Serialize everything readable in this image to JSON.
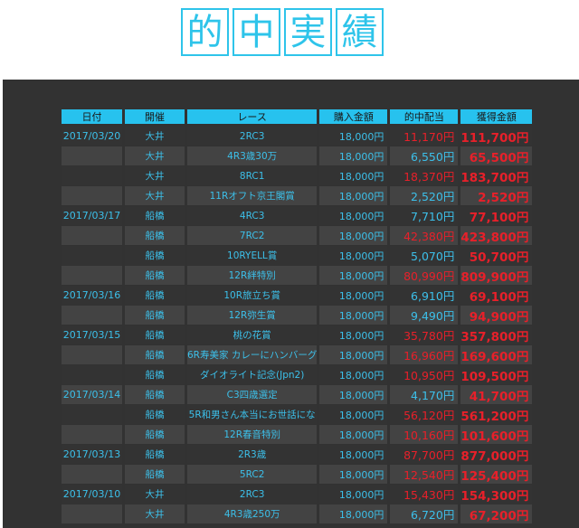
{
  "title": [
    "的",
    "中",
    "実",
    "績"
  ],
  "table": {
    "headers": [
      "日付",
      "開催",
      "レース",
      "購入金額",
      "的中配当",
      "獲得金額"
    ],
    "rows": [
      {
        "date": "2017/03/20",
        "venue": "大井",
        "race": "2RC3",
        "buy": "18,000円",
        "payout": "11,170円",
        "gain": "111,700円",
        "hit": true
      },
      {
        "date": "",
        "venue": "大井",
        "race": "4R3歳30万",
        "buy": "18,000円",
        "payout": "6,550円",
        "gain": "65,500円",
        "hit": false
      },
      {
        "date": "",
        "venue": "大井",
        "race": "8RC1",
        "buy": "18,000円",
        "payout": "18,370円",
        "gain": "183,700円",
        "hit": true
      },
      {
        "date": "",
        "venue": "大井",
        "race": "11Rオフト京王閣賞",
        "buy": "18,000円",
        "payout": "2,520円",
        "gain": "2,520円",
        "hit": false
      },
      {
        "date": "2017/03/17",
        "venue": "船橋",
        "race": "4RC3",
        "buy": "18,000円",
        "payout": "7,710円",
        "gain": "77,100円",
        "hit": false
      },
      {
        "date": "",
        "venue": "船橋",
        "race": "7RC2",
        "buy": "18,000円",
        "payout": "42,380円",
        "gain": "423,800円",
        "hit": true
      },
      {
        "date": "",
        "venue": "船橋",
        "race": "10RYELL賞",
        "buy": "18,000円",
        "payout": "5,070円",
        "gain": "50,700円",
        "hit": false
      },
      {
        "date": "",
        "venue": "船橋",
        "race": "12R絆特別",
        "buy": "18,000円",
        "payout": "80,990円",
        "gain": "809,900円",
        "hit": true
      },
      {
        "date": "2017/03/16",
        "venue": "船橋",
        "race": "10R旅立ち賞",
        "buy": "18,000円",
        "payout": "6,910円",
        "gain": "69,100円",
        "hit": false
      },
      {
        "date": "",
        "venue": "船橋",
        "race": "12R弥生賞",
        "buy": "18,000円",
        "payout": "9,490円",
        "gain": "94,900円",
        "hit": false
      },
      {
        "date": "2017/03/15",
        "venue": "船橋",
        "race": "桃の花賞",
        "buy": "18,000円",
        "payout": "35,780円",
        "gain": "357,800円",
        "hit": true
      },
      {
        "date": "",
        "venue": "船橋",
        "race": "6R寿美家 カレーにハンバーグ",
        "buy": "18,000円",
        "payout": "16,960円",
        "gain": "169,600円",
        "hit": true
      },
      {
        "date": "",
        "venue": "船橋",
        "race": "ダイオライト記念(Jpn2)",
        "buy": "18,000円",
        "payout": "10,950円",
        "gain": "109,500円",
        "hit": true
      },
      {
        "date": "2017/03/14",
        "venue": "船橋",
        "race": "C3四歳選定",
        "buy": "18,000円",
        "payout": "4,170円",
        "gain": "41,700円",
        "hit": false
      },
      {
        "date": "",
        "venue": "船橋",
        "race": "5R和男さん本当にお世話にな",
        "buy": "18,000円",
        "payout": "56,120円",
        "gain": "561,200円",
        "hit": true
      },
      {
        "date": "",
        "venue": "船橋",
        "race": "12R春音特別",
        "buy": "18,000円",
        "payout": "10,160円",
        "gain": "101,600円",
        "hit": true
      },
      {
        "date": "2017/03/13",
        "venue": "船橋",
        "race": "2R3歳",
        "buy": "18,000円",
        "payout": "87,700円",
        "gain": "877,000円",
        "hit": true
      },
      {
        "date": "",
        "venue": "船橋",
        "race": "5RC2",
        "buy": "18,000円",
        "payout": "12,540円",
        "gain": "125,400円",
        "hit": true
      },
      {
        "date": "2017/03/10",
        "venue": "大井",
        "race": "2RC3",
        "buy": "18,000円",
        "payout": "15,430円",
        "gain": "154,300円",
        "hit": true
      },
      {
        "date": "",
        "venue": "大井",
        "race": "4R3歳250万",
        "buy": "18,000円",
        "payout": "6,720円",
        "gain": "67,200円",
        "hit": false
      }
    ]
  }
}
